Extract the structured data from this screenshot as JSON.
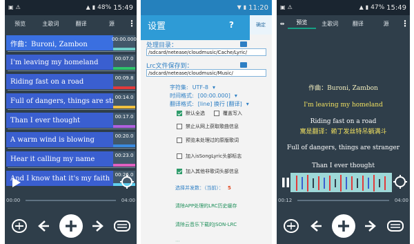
{
  "screen1": {
    "status": {
      "battery": "48%",
      "time": "15:49"
    },
    "tabs": [
      "预览",
      "主歌词",
      "翻译",
      "源"
    ],
    "lyrics": [
      {
        "text": "作曲：Buroni, Zambon",
        "time": "00:00.000",
        "bar": "#6fd0c8"
      },
      {
        "text": "I'm leaving my homeland",
        "time": "00:07.0",
        "bar": "#2ec36a"
      },
      {
        "text": "Riding fast on a road",
        "time": "00:09.8",
        "bar": "#e23a3a"
      },
      {
        "text": "Full of dangers, things are stra",
        "time": "00:14.0",
        "bar": "#f0c040"
      },
      {
        "text": "Than I ever thought",
        "time": "00:17.0",
        "bar": "#b060e0"
      },
      {
        "text": "A warm wind is blowing",
        "time": "00:20.0",
        "bar": "#3a8ae0"
      },
      {
        "text": "Hear it calling my name",
        "time": "00:23.0",
        "bar": "#e060c0"
      },
      {
        "text": "And I know that it's my faith",
        "time": "00:26.0",
        "bar": "#60d0f0"
      }
    ],
    "seek": {
      "left": "00:00",
      "right": "04:00"
    }
  },
  "screen2": {
    "status": {
      "time": "11:20"
    },
    "title": "设置",
    "help": "?",
    "confirm": "确定",
    "proc_dir_label": "处理目录：",
    "proc_dir_value": "/sdcard/netease/cloudmusic/Cache/Lyric/",
    "lrc_dir_label": "Lrc文件保存到：",
    "lrc_dir_value": "/sdcard/netease/cloudmusic/Music/",
    "charset_label": "字符集:",
    "charset_value": "UTF-8",
    "timefmt_label": "时间格式:",
    "timefmt_value": "[00:00.000]",
    "transfmt_label": "翻译格式:",
    "transfmt_value": "[line] 换行 [翻译]",
    "options": [
      {
        "label": "默认全选",
        "checked": true
      },
      {
        "label": "覆盖写入",
        "checked": false
      },
      {
        "label": "禁止从网上获取歌曲信息",
        "checked": false
      },
      {
        "label": "预览未处理过的原版歌词",
        "checked": false
      },
      {
        "label": "加入isSongLyric头部标志",
        "checked": false
      },
      {
        "label": "加入其他非歌词头部信息",
        "checked": true
      }
    ],
    "concurrency_label": "选择并发数：（当前）：",
    "concurrency_value": "5",
    "link1": "清除APP处理的LRC历史缓存",
    "link2": "清除云音乐下载的JSON-LRC"
  },
  "screen3": {
    "status": {
      "battery": "47%",
      "time": "15:49"
    },
    "tabs": [
      "预览",
      "主歌词",
      "翻译",
      "源"
    ],
    "lines": [
      {
        "text": "作曲：Buroni, Zambon",
        "color": "#f5f0c0"
      },
      {
        "text": "I'm leaving my homeland",
        "color": "#f0e060"
      },
      {
        "text": "Riding fast on a road",
        "color": "#ffffff"
      },
      {
        "text": "寓是翻译：赖丁发丝特吊躺满斗",
        "color": "#f0e060"
      },
      {
        "text": "Full of dangers, things are stranger",
        "color": "#ffffff"
      },
      {
        "text": "Than I ever thought",
        "color": "#ffffff"
      }
    ],
    "seek": {
      "left": "00:12",
      "right": "04:00"
    }
  },
  "colors": {
    "header": "#2e9bd6",
    "dark": "#2f3e4a",
    "accent": "#16a085"
  }
}
